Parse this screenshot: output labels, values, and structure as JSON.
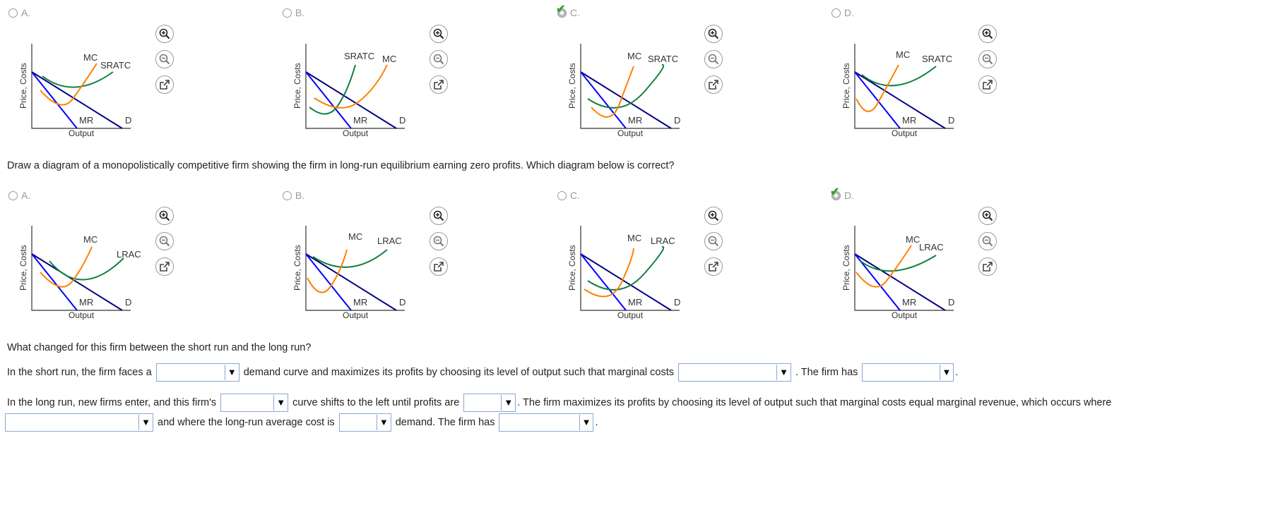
{
  "colors": {
    "mc": "#ff8000",
    "atc": "#118040",
    "demand": "#000080",
    "mr": "#0000ff"
  },
  "prompt": "Draw a diagram of a monopolistically competitive firm showing the firm in long-run equilibrium earning zero profits. Which diagram below is correct?",
  "top_options": [
    {
      "label": "A.",
      "selected": false,
      "correct": false,
      "cost_label": "SRATC"
    },
    {
      "label": "B.",
      "selected": false,
      "correct": false,
      "cost_label": "SRATC"
    },
    {
      "label": "C.",
      "selected": true,
      "correct": true,
      "cost_label": "SRATC"
    },
    {
      "label": "D.",
      "selected": false,
      "correct": false,
      "cost_label": "SRATC"
    }
  ],
  "bottom_options": [
    {
      "label": "A.",
      "selected": false,
      "correct": false,
      "cost_label": "LRAC"
    },
    {
      "label": "B.",
      "selected": false,
      "correct": false,
      "cost_label": "LRAC"
    },
    {
      "label": "C.",
      "selected": false,
      "correct": false,
      "cost_label": "LRAC"
    },
    {
      "label": "D.",
      "selected": true,
      "correct": true,
      "cost_label": "LRAC"
    }
  ],
  "graph_labels": {
    "y_axis": "Price, Costs",
    "x_axis": "Output",
    "mc": "MC",
    "mr": "MR",
    "demand": "D"
  },
  "icons": [
    "zoom-in-icon",
    "zoom-out-icon",
    "external-link-icon"
  ],
  "question2": "What changed for this firm between the short run and the long run?",
  "s1": {
    "t1": "In the short run, the firm faces a",
    "t2": "demand curve and maximizes its profits by choosing its level of output such that marginal costs",
    "t3": ". The firm has",
    "t4": "."
  },
  "s2": {
    "t1": "In the long run, new firms enter, and this firm's",
    "t2": "curve shifts to the left until profits are",
    "t3": ". The firm maximizes its profits by choosing its level of output such that marginal costs equal marginal revenue, which occurs where",
    "t4": "and where the long-run average cost is",
    "t5": "demand. The firm has",
    "t6": "."
  },
  "dropdown_arrow": "▼"
}
